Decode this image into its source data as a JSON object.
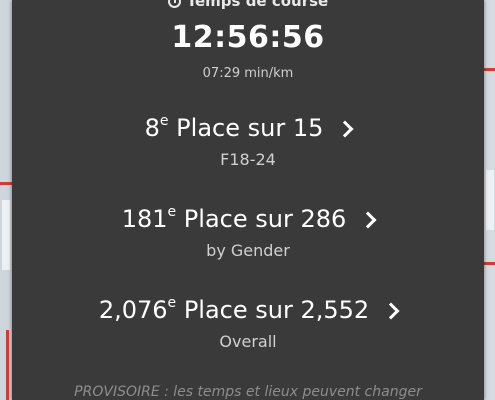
{
  "header": {
    "title": "Temps de course",
    "clock_icon": "clock-icon"
  },
  "result": {
    "time": "12:56:56",
    "pace": "07:29 min/km"
  },
  "placements": [
    {
      "rank": "8",
      "suffix": "e",
      "label": "Place sur 15",
      "category": "F18-24"
    },
    {
      "rank": "181",
      "suffix": "e",
      "label": "Place sur 286",
      "category": "by Gender"
    },
    {
      "rank": "2,076",
      "suffix": "e",
      "label": "Place sur 2,552",
      "category": "Overall"
    }
  ],
  "footer": {
    "disclaimer": "PROVISOIRE : les temps et lieux peuvent changer"
  },
  "colors": {
    "panel_bg": "#3a3a3a",
    "text_primary": "#ffffff",
    "text_secondary": "#d0d0d0",
    "map_route": "#d23b3b"
  }
}
